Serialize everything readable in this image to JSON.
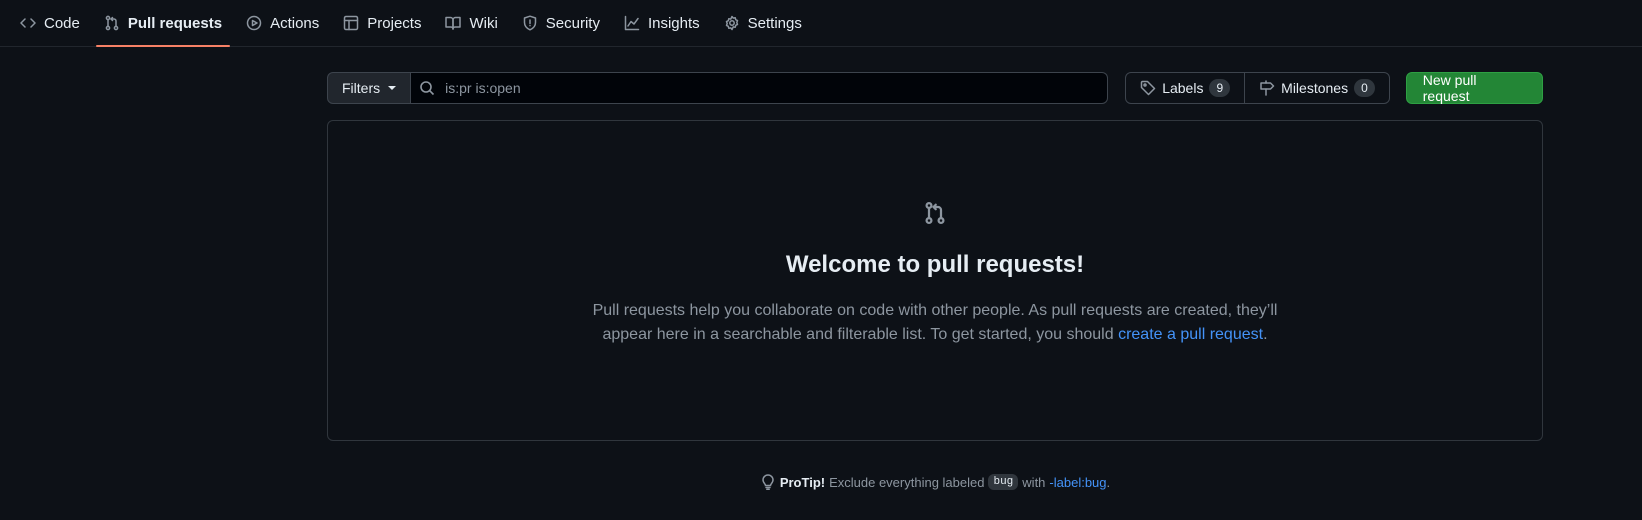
{
  "nav": {
    "tabs": [
      {
        "label": "Code",
        "icon": "code-icon"
      },
      {
        "label": "Pull requests",
        "icon": "git-pull-request-icon"
      },
      {
        "label": "Actions",
        "icon": "play-icon"
      },
      {
        "label": "Projects",
        "icon": "table-icon"
      },
      {
        "label": "Wiki",
        "icon": "book-icon"
      },
      {
        "label": "Security",
        "icon": "shield-icon"
      },
      {
        "label": "Insights",
        "icon": "graph-icon"
      },
      {
        "label": "Settings",
        "icon": "gear-icon"
      }
    ],
    "active": "Pull requests",
    "active_underline_color": "#f78166"
  },
  "toolbar": {
    "filters_label": "Filters",
    "search_value": "is:pr is:open",
    "labels_label": "Labels",
    "labels_count": "9",
    "milestones_label": "Milestones",
    "milestones_count": "0",
    "new_pr_label": "New pull request",
    "new_pr_color": "#238636"
  },
  "blankslate": {
    "icon": "git-pull-request-icon",
    "title": "Welcome to pull requests!",
    "text": "Pull requests help you collaborate on code with other people. As pull requests are created, they’ll appear here in a searchable and filterable list. To get started, you should ",
    "link_text": "create a pull request",
    "trailing": "."
  },
  "protip": {
    "icon": "light-bulb-icon",
    "strong": "ProTip!",
    "text_before": "Exclude everything labeled",
    "label_code": "bug",
    "text_middle": "with",
    "link_text": "-label:bug",
    "trailing": "."
  }
}
